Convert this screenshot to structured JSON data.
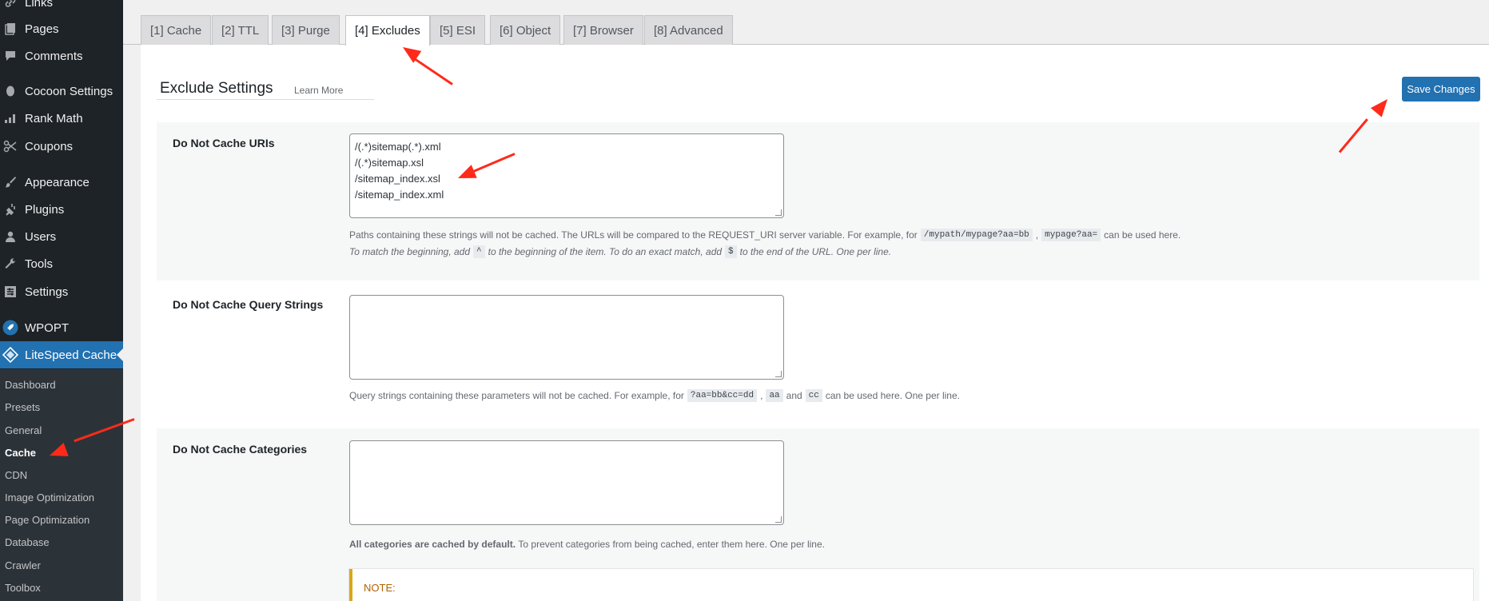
{
  "sidebar": {
    "items": [
      {
        "label": "Links",
        "icon": "links-icon"
      },
      {
        "label": "Pages",
        "icon": "pages-icon"
      },
      {
        "label": "Comments",
        "icon": "comments-icon"
      },
      {
        "label": "Cocoon Settings",
        "icon": "cocoon-icon"
      },
      {
        "label": "Rank Math",
        "icon": "rank-math-icon"
      },
      {
        "label": "Coupons",
        "icon": "scissors-icon"
      },
      {
        "label": "Appearance",
        "icon": "paintbrush-icon"
      },
      {
        "label": "Plugins",
        "icon": "plugin-icon"
      },
      {
        "label": "Users",
        "icon": "user-icon"
      },
      {
        "label": "Tools",
        "icon": "wrench-icon"
      },
      {
        "label": "Settings",
        "icon": "settings-icon"
      },
      {
        "label": "WPOPT",
        "icon": "rocket-icon"
      },
      {
        "label": "LiteSpeed Cache",
        "icon": "litespeed-icon"
      }
    ],
    "submenu": [
      "Dashboard",
      "Presets",
      "General",
      "Cache",
      "CDN",
      "Image Optimization",
      "Page Optimization",
      "Database",
      "Crawler",
      "Toolbox"
    ],
    "current_submenu": "Cache"
  },
  "tabs": [
    "[1] Cache",
    "[2] TTL",
    "[3] Purge",
    "[4] Excludes",
    "[5] ESI",
    "[6] Object",
    "[7] Browser",
    "[8] Advanced"
  ],
  "active_tab": "[4] Excludes",
  "header": {
    "title": "Exclude Settings",
    "learn_more": "Learn More",
    "save_label": "Save Changes"
  },
  "settings": {
    "uris": {
      "label": "Do Not Cache URIs",
      "lines": [
        "/(.*)sitemap(.*).xml",
        "/(.*)sitemap.xsl",
        "/sitemap_index.xsl",
        "/sitemap_index.xml"
      ],
      "desc1_a": "Paths containing these strings will not be cached. The URLs will be compared to the REQUEST_URI server variable. For example, for",
      "desc1_code1": "/mypath/mypage?aa=bb",
      "desc1_sep": ",",
      "desc1_code2": "mypage?aa=",
      "desc1_b": "can be used here.",
      "desc2_a": "To match the beginning, add",
      "desc2_code1": "^",
      "desc2_b": "to the beginning of the item. To do an exact match, add",
      "desc2_code2": "$",
      "desc2_c": "to the end of the URL. One per line."
    },
    "query_strings": {
      "label": "Do Not Cache Query Strings",
      "desc_a": "Query strings containing these parameters will not be cached. For example, for",
      "code1": "?aa=bb&cc=dd",
      "sep": ",",
      "code2": "aa",
      "and": "and",
      "code3": "cc",
      "desc_b": "can be used here. One per line."
    },
    "categories": {
      "label": "Do Not Cache Categories",
      "desc_bold": "All categories are cached by default.",
      "desc_rest": "To prevent categories from being cached, enter them here. One per line.",
      "note": "NOTE:"
    }
  },
  "colors": {
    "accent": "#2271b1",
    "sidebar_bg": "#1d2327",
    "annotation_arrow": "#ff2a1a",
    "note_border": "#dba617"
  }
}
